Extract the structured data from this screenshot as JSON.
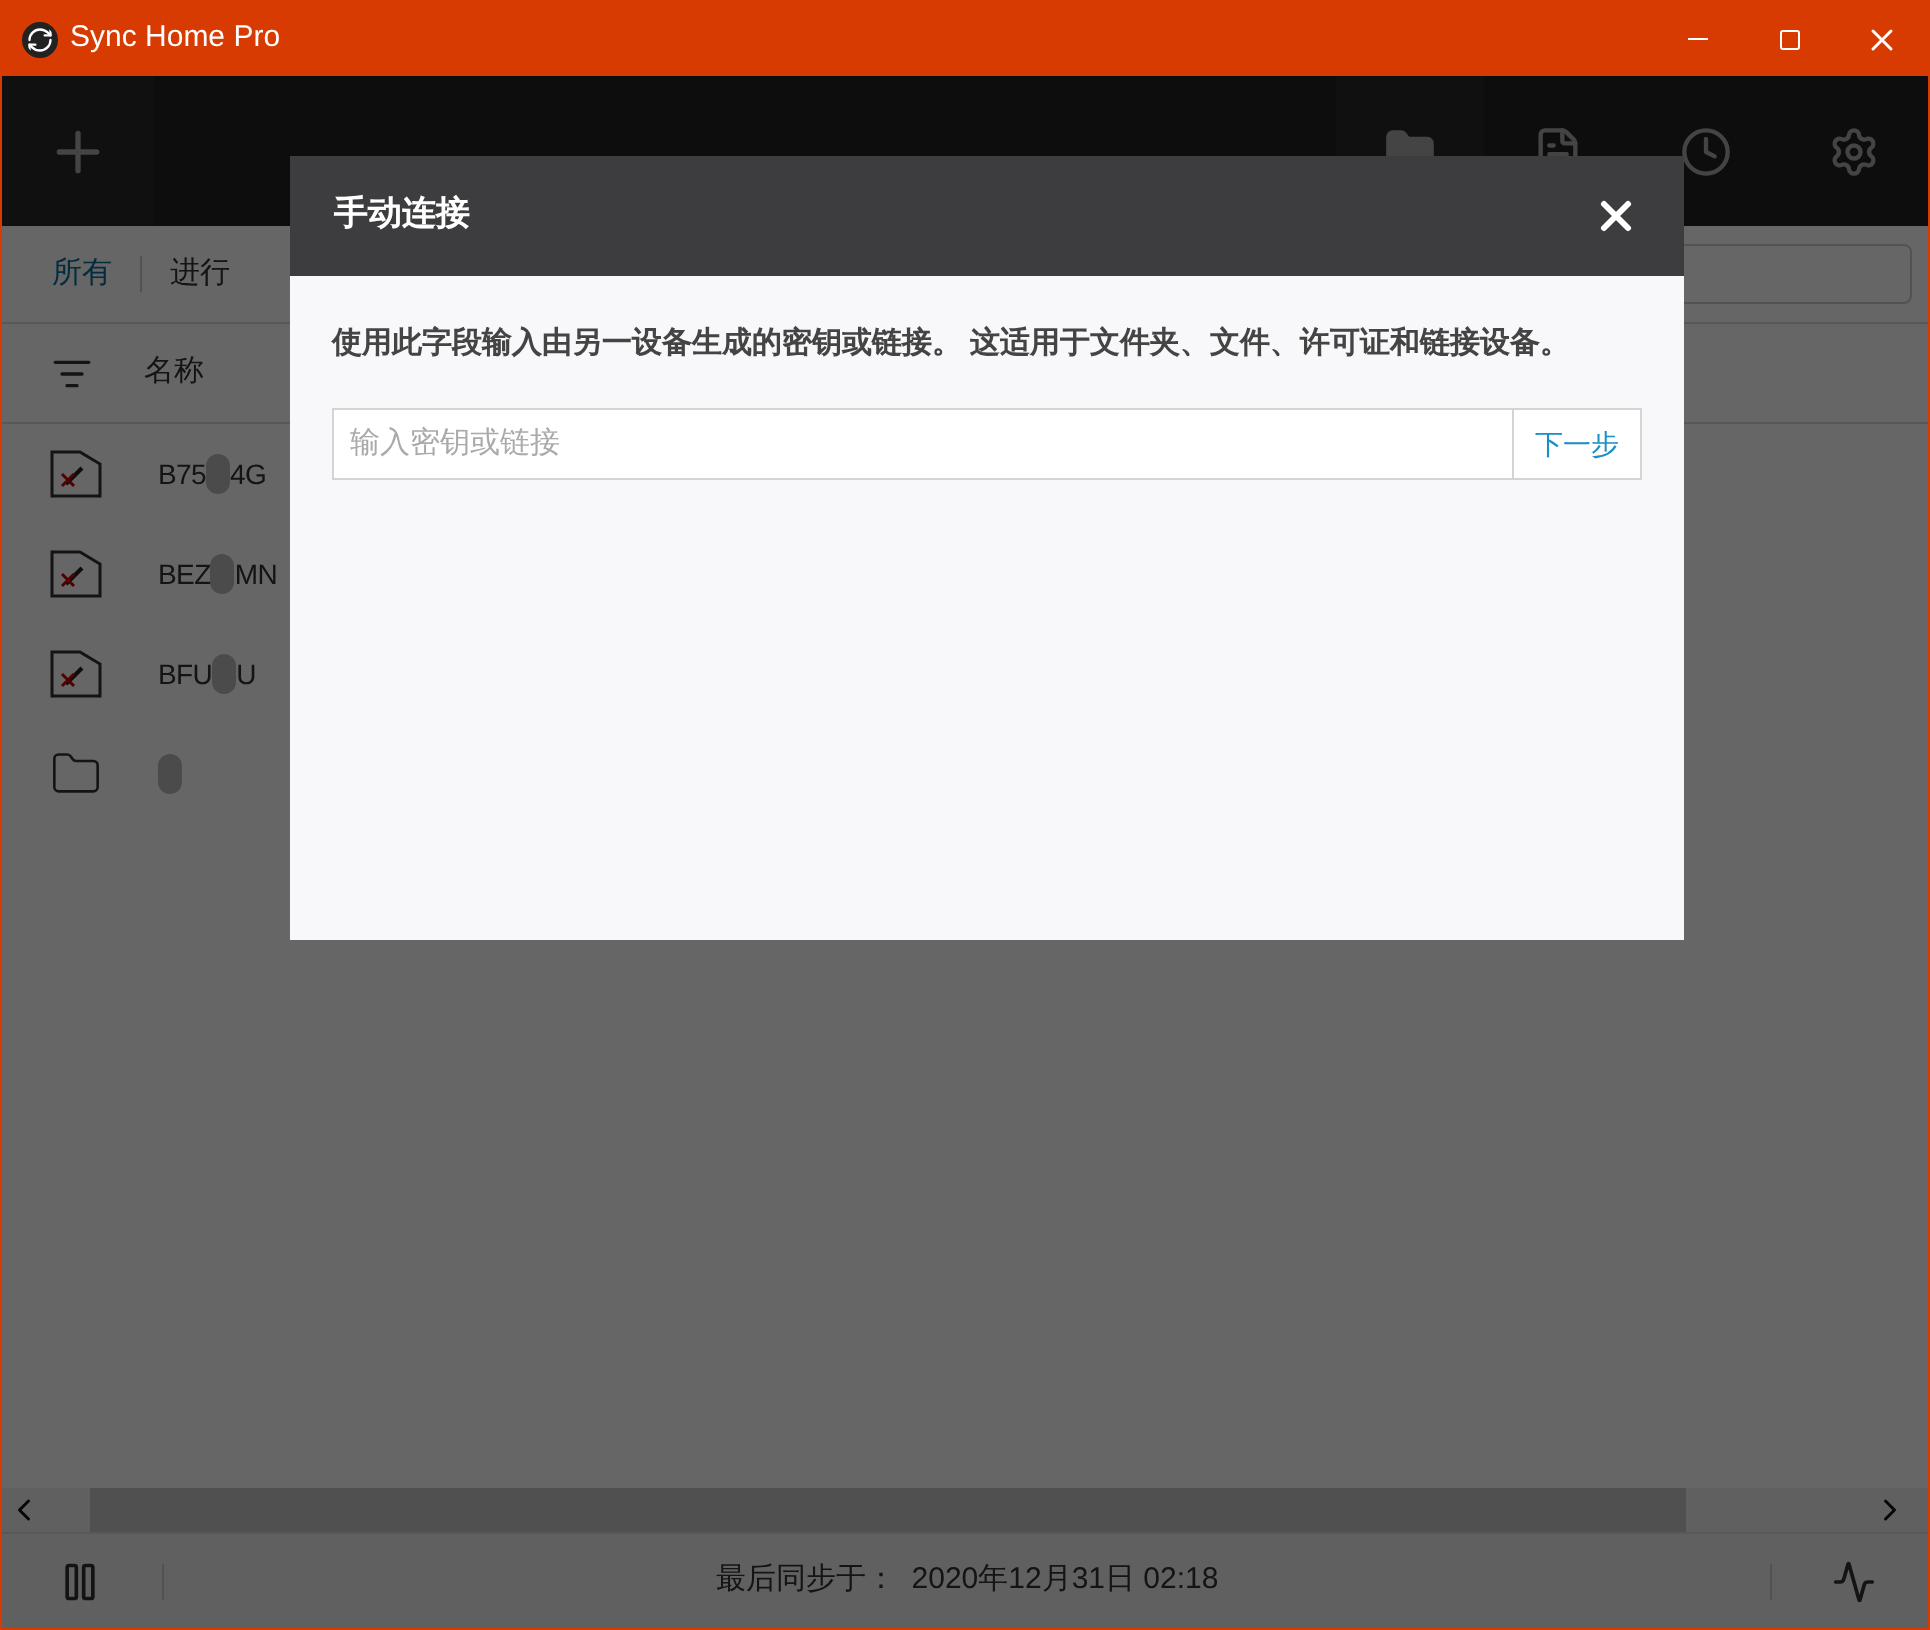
{
  "window": {
    "title": "Sync Home Pro"
  },
  "tabs": [
    {
      "label": "所有",
      "selected": true
    },
    {
      "label": "进行",
      "selected": false
    }
  ],
  "table": {
    "columns": [
      "名称"
    ],
    "rows": [
      {
        "kind": "error",
        "name_start": "B75",
        "name_end": "4G"
      },
      {
        "kind": "error",
        "name_start": "BEZ",
        "name_end": "MN"
      },
      {
        "kind": "error",
        "name_start": "BFU",
        "name_end": "U"
      },
      {
        "kind": "folder",
        "name_start": "",
        "name_end": ""
      }
    ]
  },
  "status_bar": {
    "label": "最后同步于：",
    "time": "2020年12月31日 02:18"
  },
  "dialog": {
    "title": "手动连接",
    "description": "使用此字段输入由另一设备生成的密钥或链接。 这适用于文件夹、文件、许可证和链接设备。",
    "input_placeholder": "输入密钥或链接",
    "next_button": "下一步"
  }
}
